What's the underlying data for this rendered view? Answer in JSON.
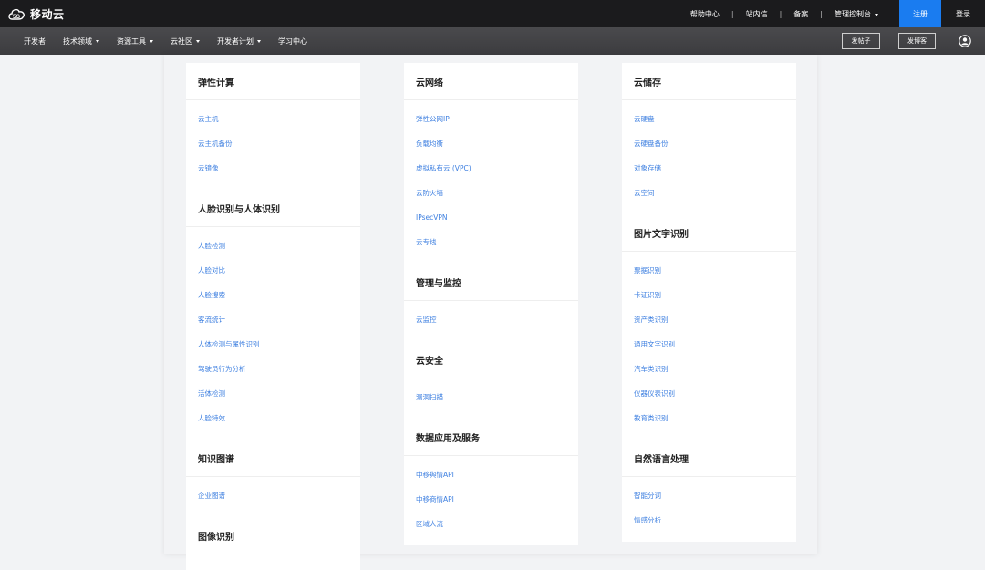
{
  "brand": {
    "logo_text": "移动云",
    "logo_mark": "5G"
  },
  "topnav": {
    "items": [
      "帮助中心",
      "站内信",
      "备案",
      "管理控制台"
    ],
    "separator": "|",
    "register": "注册",
    "login": "登录"
  },
  "subnav": {
    "items": [
      {
        "label": "开发者",
        "dropdown": false
      },
      {
        "label": "技术领域",
        "dropdown": true
      },
      {
        "label": "资源工具",
        "dropdown": true
      },
      {
        "label": "云社区",
        "dropdown": true
      },
      {
        "label": "开发者计划",
        "dropdown": true
      },
      {
        "label": "学习中心",
        "dropdown": false
      }
    ],
    "post_button": "发帖子",
    "blog_button": "发博客"
  },
  "columns": [
    {
      "sections": [
        {
          "title": "弹性计算",
          "links": [
            "云主机",
            "云主机备份",
            "云镜像"
          ]
        },
        {
          "title": "人脸识别与人体识别",
          "links": [
            "人脸检测",
            "人脸对比",
            "人脸搜索",
            "客流统计",
            "人体检测与属性识别",
            "驾驶员行为分析",
            "活体检测",
            "人脸特效"
          ]
        },
        {
          "title": "知识图谱",
          "links": [
            "企业图谱"
          ]
        },
        {
          "title": "图像识别",
          "links": []
        }
      ]
    },
    {
      "sections": [
        {
          "title": "云网络",
          "links": [
            "弹性公网IP",
            "负载均衡",
            "虚拟私有云 (VPC)",
            "云防火墙",
            "IPsecVPN",
            "云专线"
          ]
        },
        {
          "title": "管理与监控",
          "links": [
            "云监控"
          ]
        },
        {
          "title": "云安全",
          "links": [
            "漏洞扫描"
          ]
        },
        {
          "title": "数据应用及服务",
          "links": [
            "中移舆情API",
            "中移商情API",
            "区域人流"
          ]
        }
      ]
    },
    {
      "sections": [
        {
          "title": "云储存",
          "links": [
            "云硬盘",
            "云硬盘备份",
            "对象存储",
            "云空间"
          ]
        },
        {
          "title": "图片文字识别",
          "links": [
            "票据识别",
            "卡证识别",
            "资产类识别",
            "通用文字识别",
            "汽车类识别",
            "仪器仪表识别",
            "教育类识别"
          ]
        },
        {
          "title": "自然语言处理",
          "links": [
            "智能分词",
            "情感分析"
          ]
        }
      ]
    }
  ],
  "colors": {
    "accent": "#1a7cf0",
    "link": "#3d7fe0",
    "topbar": "#1b1b1d"
  }
}
